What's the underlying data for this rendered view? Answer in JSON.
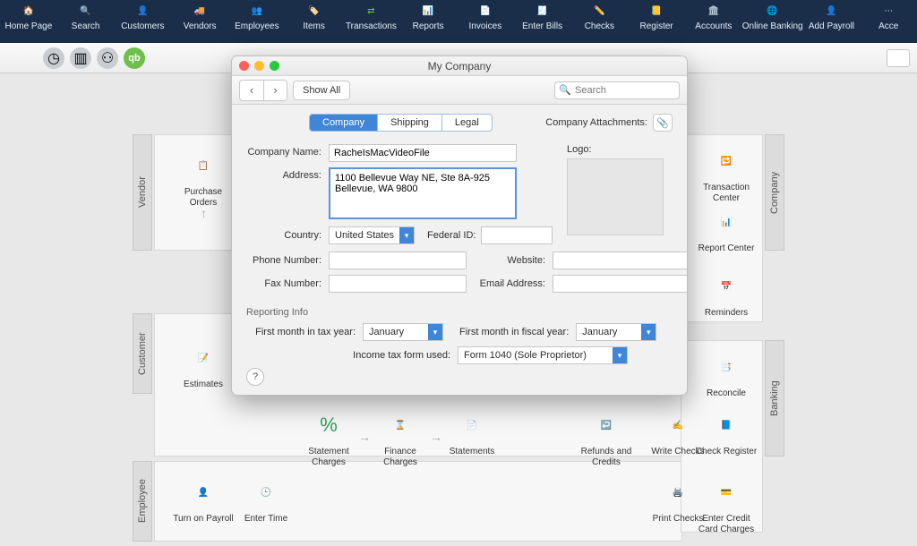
{
  "toolbar": [
    {
      "label": "Home Page",
      "icon": "home"
    },
    {
      "label": "Search",
      "icon": "search"
    },
    {
      "label": "Customers",
      "icon": "person"
    },
    {
      "label": "Vendors",
      "icon": "truck"
    },
    {
      "label": "Employees",
      "icon": "group"
    },
    {
      "label": "Items",
      "icon": "tag"
    },
    {
      "label": "Transactions",
      "icon": "swap"
    },
    {
      "label": "Reports",
      "icon": "chart"
    },
    {
      "label": "Invoices",
      "icon": "invoice"
    },
    {
      "label": "Enter Bills",
      "icon": "bill"
    },
    {
      "label": "Checks",
      "icon": "pencil"
    },
    {
      "label": "Register",
      "icon": "register"
    },
    {
      "label": "Accounts",
      "icon": "bank"
    },
    {
      "label": "Online Banking",
      "icon": "globe"
    },
    {
      "label": "Add Payroll",
      "icon": "payroll"
    },
    {
      "label": "Acce",
      "icon": "more"
    }
  ],
  "side_left": [
    "Vendor",
    "Customer",
    "Employee"
  ],
  "side_right": [
    "Company",
    "Banking"
  ],
  "workflow_left": {
    "purchase_orders": "Purchase Orders",
    "estimates": "Estimates",
    "statement_charges": "Statement Charges",
    "finance_charges": "Finance Charges",
    "statements": "Statements",
    "refunds": "Refunds and Credits",
    "turn_on_payroll": "Turn on Payroll",
    "enter_time": "Enter Time"
  },
  "workflow_right": {
    "transaction_center": "Transaction Center",
    "report_center": "Report Center",
    "reminders": "Reminders",
    "reconcile": "Reconcile",
    "write_checks": "Write Checks",
    "check_register": "Check Register",
    "print_checks": "Print Checks",
    "enter_cc": "Enter Credit Card Charges"
  },
  "modal": {
    "title": "My Company",
    "show_all": "Show All",
    "search_placeholder": "Search",
    "tabs": [
      "Company",
      "Shipping",
      "Legal"
    ],
    "active_tab": "Company",
    "attachments_label": "Company Attachments:",
    "labels": {
      "company_name": "Company Name:",
      "address": "Address:",
      "logo": "Logo:",
      "country": "Country:",
      "federal_id": "Federal ID:",
      "phone": "Phone Number:",
      "fax": "Fax Number:",
      "website": "Website:",
      "email": "Email Address:",
      "reporting": "Reporting Info",
      "first_tax": "First month in tax year:",
      "first_fiscal": "First month in fiscal year:",
      "income_tax_form": "Income tax form used:"
    },
    "values": {
      "company_name": "RacheIsMacVideoFile",
      "address": "1100 Bellevue Way NE, Ste 8A-925\nBellevue, WA 9800",
      "country": "United States",
      "federal_id": "",
      "phone": "",
      "fax": "",
      "website": "",
      "email": "",
      "first_tax": "January",
      "first_fiscal": "January",
      "income_tax_form": "Form 1040 (Sole Proprietor)"
    },
    "help": "?"
  }
}
